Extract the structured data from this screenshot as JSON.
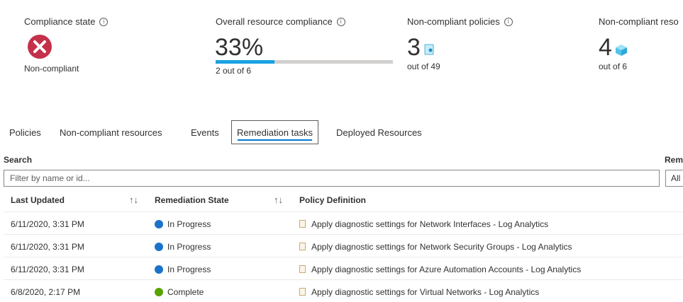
{
  "summary": {
    "compliance_state": {
      "title": "Compliance state",
      "value": "Non-compliant",
      "status_color": "#c4314b"
    },
    "overall_compliance": {
      "title": "Overall resource compliance",
      "value": "33%",
      "detail": "2 out of 6",
      "progress_percent": 33
    },
    "noncompliant_policies": {
      "title": "Non-compliant policies",
      "value": "3",
      "detail": "out of 49",
      "icon": "policy-icon"
    },
    "noncompliant_resources": {
      "title": "Non-compliant reso",
      "value": "4",
      "detail": "out of 6",
      "icon": "cube-icon"
    },
    "info_glyph": "i"
  },
  "tabs": [
    {
      "label": "Policies"
    },
    {
      "label": "Non-compliant resources"
    },
    {
      "label": "Events"
    },
    {
      "label": "Remediation tasks",
      "active": true
    },
    {
      "label": "Deployed Resources"
    }
  ],
  "filters": {
    "search_label": "Search",
    "search_placeholder": "Filter by name or id...",
    "second_label": "Rem",
    "second_value": "All"
  },
  "table": {
    "headers": [
      "Last Updated",
      "Remediation State",
      "Policy Definition"
    ],
    "sort_glyph": "↑↓",
    "rows": [
      {
        "updated": "6/11/2020, 3:31 PM",
        "state": "In Progress",
        "state_type": "progress",
        "policy": "Apply diagnostic settings for Network Interfaces - Log Analytics"
      },
      {
        "updated": "6/11/2020, 3:31 PM",
        "state": "In Progress",
        "state_type": "progress",
        "policy": "Apply diagnostic settings for Network Security Groups - Log Analytics"
      },
      {
        "updated": "6/11/2020, 3:31 PM",
        "state": "In Progress",
        "state_type": "progress",
        "policy": "Apply diagnostic settings for Azure Automation Accounts - Log Analytics"
      },
      {
        "updated": "6/8/2020, 2:17 PM",
        "state": "Complete",
        "state_type": "complete",
        "policy": "Apply diagnostic settings for Virtual Networks - Log Analytics"
      }
    ]
  },
  "colors": {
    "accent": "#0078d4",
    "progress": "#1ba1e2",
    "error": "#c4314b",
    "in_progress": "#1a73c8",
    "complete": "#57a300"
  }
}
